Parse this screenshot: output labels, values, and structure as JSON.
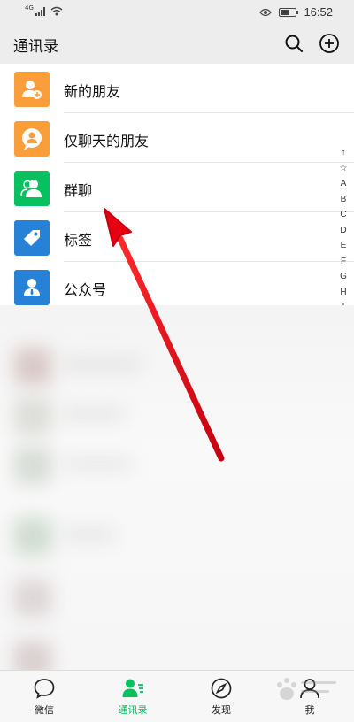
{
  "status_bar": {
    "network": "4G",
    "time": "16:52"
  },
  "header": {
    "title": "通讯录",
    "search_icon": "search-icon",
    "add_icon": "plus-circle-icon"
  },
  "contacts": {
    "items": [
      {
        "label": "新的朋友",
        "icon": "add-friend-icon",
        "color": "#fa9d3b"
      },
      {
        "label": "仅聊天的朋友",
        "icon": "chat-only-friend-icon",
        "color": "#fa9d3b"
      },
      {
        "label": "群聊",
        "icon": "group-chat-icon",
        "color": "#07c160"
      },
      {
        "label": "标签",
        "icon": "tag-icon",
        "color": "#2782d7"
      },
      {
        "label": "公众号",
        "icon": "official-account-icon",
        "color": "#2782d7"
      }
    ]
  },
  "alphabet_index": [
    "↑",
    "☆",
    "A",
    "B",
    "C",
    "D",
    "E",
    "F",
    "G",
    "H",
    "I"
  ],
  "tab_bar": {
    "tabs": [
      {
        "label": "微信",
        "icon": "chat-bubble-icon"
      },
      {
        "label": "通讯录",
        "icon": "contacts-icon",
        "active": true
      },
      {
        "label": "发现",
        "icon": "compass-icon"
      },
      {
        "label": "我",
        "icon": "person-icon"
      }
    ]
  },
  "annotation": {
    "color": "#e60012"
  },
  "colors": {
    "active_green": "#07c160",
    "background": "#ededed"
  }
}
